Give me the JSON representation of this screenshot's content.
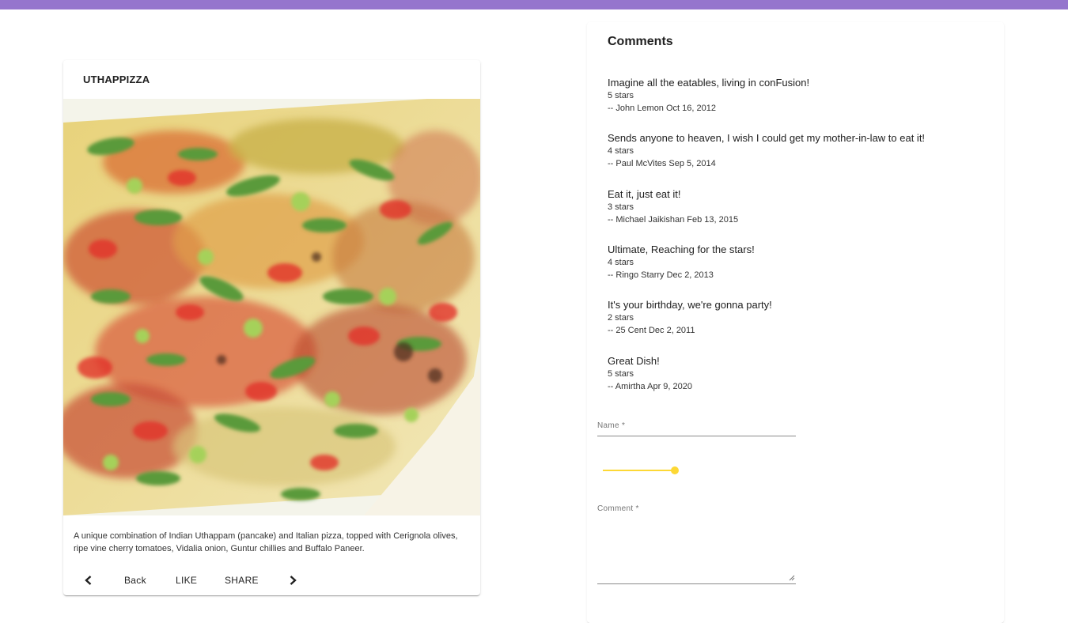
{
  "dish": {
    "name": "UTHAPPIZZA",
    "description": "A unique combination of Indian Uthappam (pancake) and Italian pizza, topped with Cerignola olives, ripe vine cherry tomatoes, Vidalia onion, Guntur chillies and Buffalo Paneer.",
    "actions": {
      "back_label": "Back",
      "like_label": "LIKE",
      "share_label": "SHARE"
    }
  },
  "comments": {
    "title": "Comments",
    "items": [
      {
        "text": "Imagine all the eatables, living in conFusion!",
        "rating": "5 stars",
        "author": "-- John Lemon Oct 16, 2012"
      },
      {
        "text": "Sends anyone to heaven, I wish I could get my mother-in-law to eat it!",
        "rating": "4 stars",
        "author": "-- Paul McVites Sep 5, 2014"
      },
      {
        "text": "Eat it, just eat it!",
        "rating": "3 stars",
        "author": "-- Michael Jaikishan Feb 13, 2015"
      },
      {
        "text": "Ultimate, Reaching for the stars!",
        "rating": "4 stars",
        "author": "-- Ringo Starry Dec 2, 2013"
      },
      {
        "text": "It's your birthday, we're gonna party!",
        "rating": "2 stars",
        "author": "-- 25 Cent Dec 2, 2011"
      },
      {
        "text": "Great Dish!",
        "rating": "5 stars",
        "author": "-- Amirtha Apr 9, 2020"
      }
    ]
  },
  "form": {
    "name_label": "Name *",
    "rating_value": 5,
    "rating_max": 5,
    "comment_label": "Comment *"
  },
  "colors": {
    "topbar": "#9575cd",
    "accent": "#fdd835"
  },
  "icons": {
    "prev": "chevron-left-icon",
    "next": "chevron-right-icon"
  }
}
